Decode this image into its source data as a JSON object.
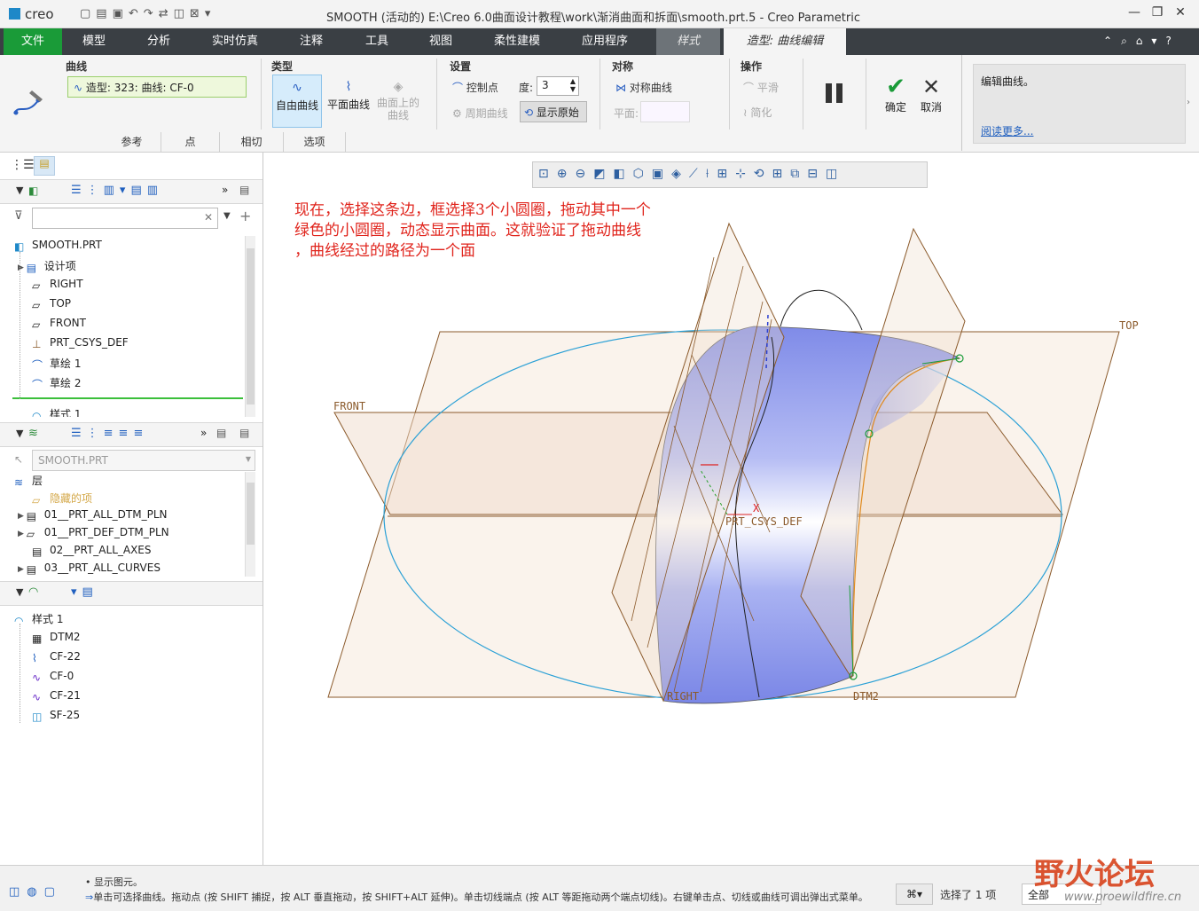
{
  "app": {
    "logo": "creo",
    "window_title": "SMOOTH (活动的) E:\\Creo 6.0曲面设计教程\\work\\渐消曲面和拆面\\smooth.prt.5 - Creo Parametric",
    "qat_icons": [
      "new-icon",
      "open-icon",
      "save-icon",
      "undo-icon",
      "redo-icon",
      "regenerate-icon",
      "window-icon",
      "close-window-icon",
      "customize-icon"
    ]
  },
  "tabs": [
    {
      "label": "文件",
      "name": "tab-file"
    },
    {
      "label": "模型",
      "name": "tab-model"
    },
    {
      "label": "分析",
      "name": "tab-analysis"
    },
    {
      "label": "实时仿真",
      "name": "tab-live-simulation"
    },
    {
      "label": "注释",
      "name": "tab-annotate"
    },
    {
      "label": "工具",
      "name": "tab-tools"
    },
    {
      "label": "视图",
      "name": "tab-view"
    },
    {
      "label": "柔性建模",
      "name": "tab-flexible-modeling"
    },
    {
      "label": "应用程序",
      "name": "tab-applications"
    },
    {
      "label": "样式",
      "name": "tab-style"
    },
    {
      "label": "造型: 曲线编辑",
      "name": "tab-curve-edit"
    }
  ],
  "ribbon": {
    "curve_group": {
      "title": "曲线",
      "field": "造型: 323: 曲线: CF-0"
    },
    "type_group": {
      "title": "类型",
      "free": "自由曲线",
      "planar": "平面曲线",
      "on_surface_1": "曲面上的",
      "on_surface_2": "曲线"
    },
    "settings_group": {
      "title": "设置",
      "control_points": "控制点",
      "degree_label": "度:",
      "degree_value": "3",
      "periodic": "周期曲线",
      "show_original": "显示原始"
    },
    "symmetry_group": {
      "title": "对称",
      "sym_curve": "对称曲线",
      "plane_label": "平面:"
    },
    "ops_group": {
      "title": "操作",
      "smooth": "平滑",
      "simplify": "简化"
    },
    "ok": "确定",
    "cancel": "取消",
    "help_text": "编辑曲线。",
    "help_link": "阅读更多...",
    "subtabs": [
      "参考",
      "点",
      "相切",
      "选项"
    ]
  },
  "model_tree": {
    "root": "SMOOTH.PRT",
    "items": [
      "设计项",
      "RIGHT",
      "TOP",
      "FRONT",
      "PRT_CSYS_DEF",
      "草绘 1",
      "草绘 2",
      "样式 1"
    ]
  },
  "layer_tree": {
    "dropdown": "SMOOTH.PRT",
    "header": "层",
    "items": [
      "隐藏的项",
      "01__PRT_ALL_DTM_PLN",
      "01__PRT_DEF_DTM_PLN",
      "02__PRT_ALL_AXES",
      "03__PRT_ALL_CURVES"
    ]
  },
  "style_tree": {
    "root": "样式 1",
    "items": [
      "DTM2",
      "CF-22",
      "CF-0",
      "CF-21",
      "SF-25"
    ]
  },
  "note": {
    "line1": "现在，选择这条边，框选择3个小圆圈，拖动其中一个",
    "line2": "绿色的小圆圈，动态显示曲面。这就验证了拖动曲线",
    "line3": "，曲线经过的路径为一个面"
  },
  "datum_labels": {
    "top": "TOP",
    "front": "FRONT",
    "right": "RIGHT",
    "csys": "PRT_CSYS_DEF",
    "x": "X",
    "dtm2": "DTM2"
  },
  "status": {
    "line1": "• 显示图元。",
    "line2": "单击可选择曲线。拖动点 (按 SHIFT 捕捉，按 ALT 垂直拖动，按 SHIFT+ALT 延伸)。单击切线端点 (按 ALT 等距拖动两个端点切线)。右键单击点、切线或曲线可调出弹出式菜单。",
    "selected": "选择了 1 项",
    "filter": "全部"
  },
  "watermark": {
    "cn": "野火论坛",
    "url": "www.proewildfire.cn"
  },
  "colors": {
    "file_tab": "#1a9b38",
    "tab_bar": "#3a3f44",
    "note": "#e0241c",
    "surface": "#8a96ee",
    "plane": "#8b5a2b"
  }
}
